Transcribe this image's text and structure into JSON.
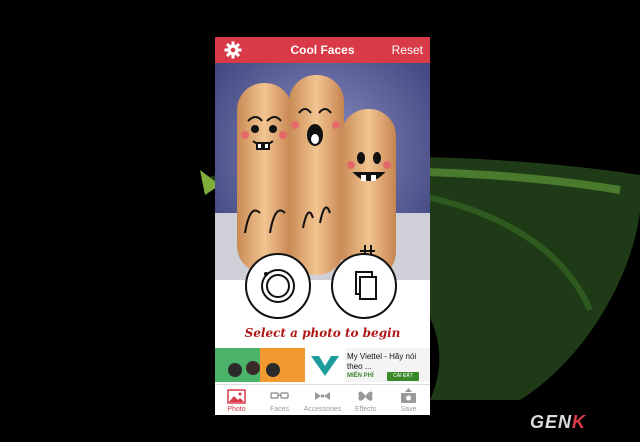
{
  "app": {
    "title": "Cool Faces",
    "reset_label": "Reset"
  },
  "main": {
    "prompt": "Select a photo to begin"
  },
  "ad": {
    "title": "My Viettel - Hãy nói",
    "subtitle": "theo ...",
    "free_label": "MIỄN PHÍ",
    "install_label": "CÀI ĐẶT"
  },
  "tabs": [
    {
      "label": "Photo",
      "icon": "photo-icon",
      "active": true
    },
    {
      "label": "Faces",
      "icon": "glasses-icon",
      "active": false
    },
    {
      "label": "Accessories",
      "icon": "bowtie-icon",
      "active": false
    },
    {
      "label": "Effects",
      "icon": "butterfly-icon",
      "active": false
    },
    {
      "label": "Save",
      "icon": "save-icon",
      "active": false
    }
  ],
  "watermark": {
    "text_main": "GEN",
    "text_accent": "K"
  },
  "colors": {
    "accent": "#d93a47",
    "prompt": "#b01818"
  }
}
